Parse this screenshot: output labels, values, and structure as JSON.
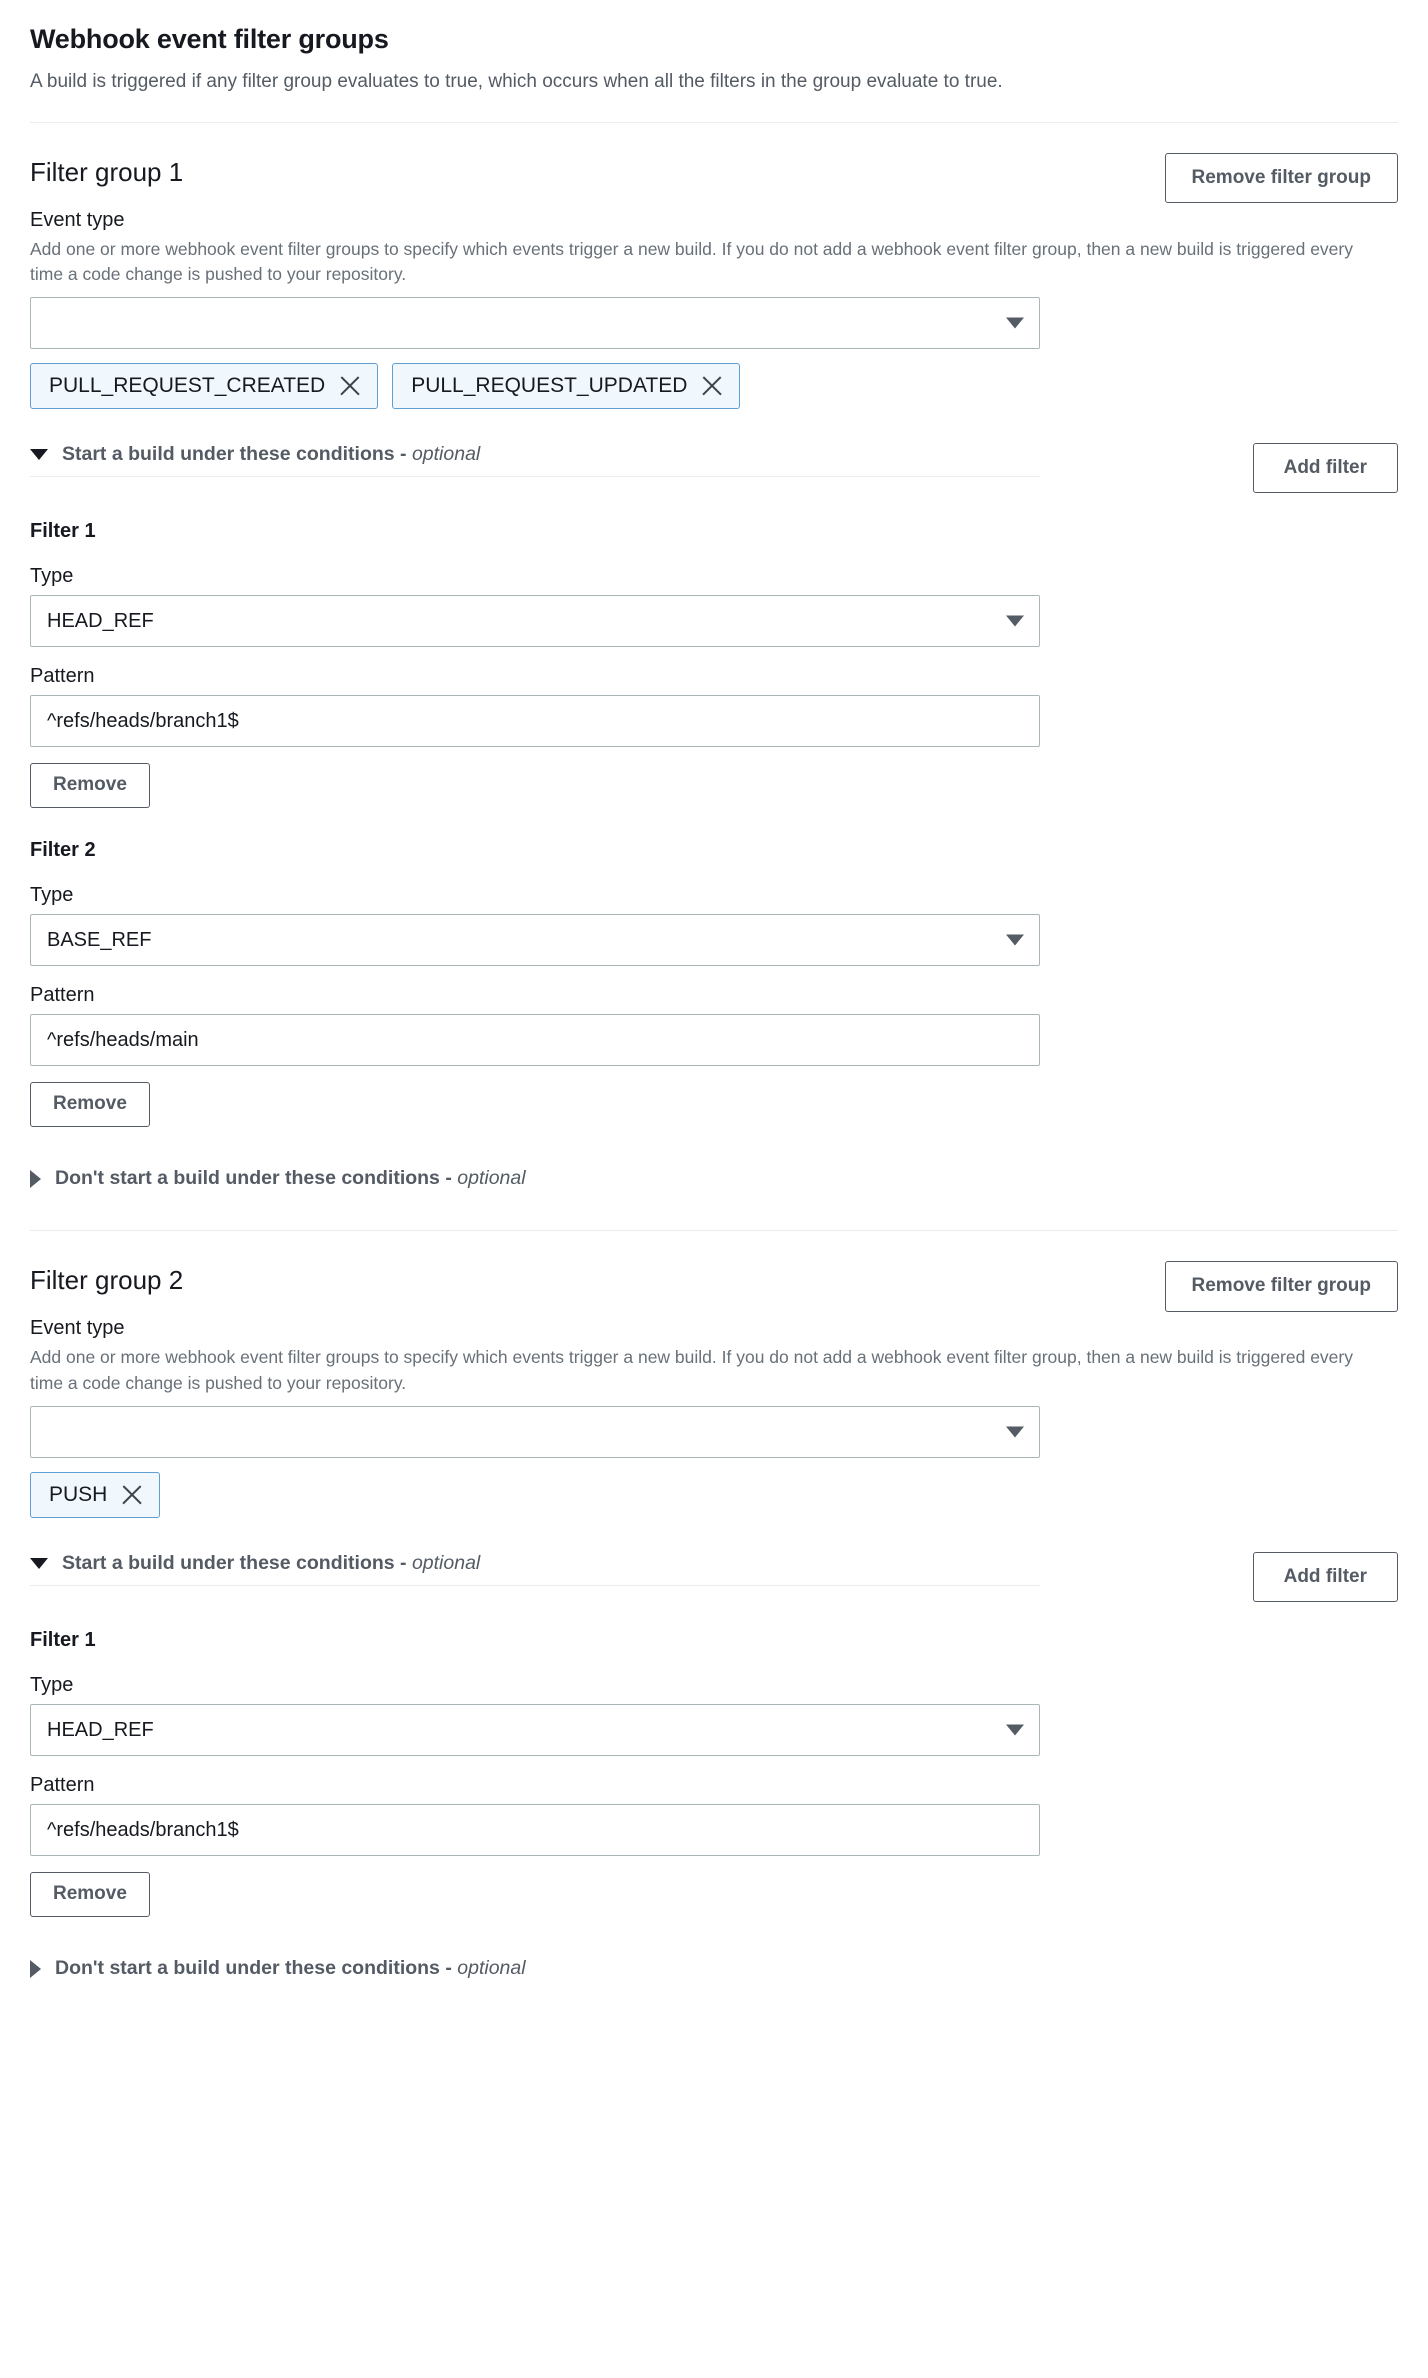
{
  "header": {
    "title": "Webhook event filter groups",
    "description": "A build is triggered if any filter group evaluates to true, which occurs when all the filters in the group evaluate to true."
  },
  "labels": {
    "event_type": "Event type",
    "event_type_hint": "Add one or more webhook event filter groups to specify which events trigger a new build. If you do not add a webhook event filter group, then a new build is triggered every time a code change is pushed to your repository.",
    "type": "Type",
    "pattern": "Pattern",
    "remove_filter_group": "Remove filter group",
    "add_filter": "Add filter",
    "remove": "Remove",
    "start_build_section": "Start a build under these conditions - ",
    "dont_start_build_section": "Don't start a build under these conditions - ",
    "optional": "optional",
    "event_type_select_value": ""
  },
  "colors": {
    "chip_bg": "#f1f8fd",
    "chip_border": "#5f9fd4",
    "border": "#aab7b8",
    "text": "#16191f",
    "muted": "#545b64",
    "divider": "#eaeded"
  },
  "groups": [
    {
      "title": "Filter group 1",
      "event_types": [
        "PULL_REQUEST_CREATED",
        "PULL_REQUEST_UPDATED"
      ],
      "filters": [
        {
          "heading": "Filter 1",
          "type": "HEAD_REF",
          "pattern": "^refs/heads/branch1$"
        },
        {
          "heading": "Filter 2",
          "type": "BASE_REF",
          "pattern": "^refs/heads/main"
        }
      ]
    },
    {
      "title": "Filter group 2",
      "event_types": [
        "PUSH"
      ],
      "filters": [
        {
          "heading": "Filter 1",
          "type": "HEAD_REF",
          "pattern": "^refs/heads/branch1$"
        }
      ]
    }
  ]
}
